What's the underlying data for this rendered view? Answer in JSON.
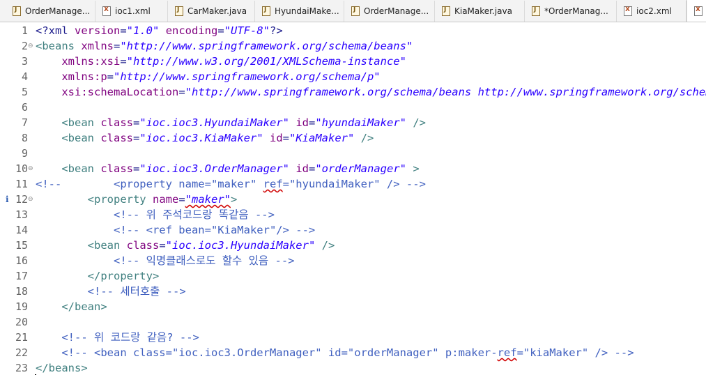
{
  "tabs": [
    {
      "label": "OrderManage...",
      "icon": "java-file-icon",
      "type": "java"
    },
    {
      "label": "ioc1.xml",
      "icon": "xml-file-icon",
      "type": "xml"
    },
    {
      "label": "CarMaker.java",
      "icon": "java-file-icon",
      "type": "java"
    },
    {
      "label": "HyundaiMake...",
      "icon": "java-file-icon",
      "type": "java"
    },
    {
      "label": "OrderManage...",
      "icon": "java-file-icon",
      "type": "java"
    },
    {
      "label": "KiaMaker.java",
      "icon": "java-file-icon",
      "type": "java"
    },
    {
      "label": "*OrderManag...",
      "icon": "java-file-icon",
      "type": "java"
    },
    {
      "label": "ioc2.xml",
      "icon": "xml-file-icon",
      "type": "xml"
    },
    {
      "label": "i",
      "icon": "xml-file-icon",
      "type": "xml",
      "active": true
    }
  ],
  "editor": {
    "lines": [
      {
        "n": "1",
        "t": [
          [
            "tg",
            "<?xml "
          ],
          [
            "an",
            "version"
          ],
          [
            "tg",
            "="
          ],
          [
            "av",
            "\"1.0\""
          ],
          [
            "tg",
            " "
          ],
          [
            "an",
            "encoding"
          ],
          [
            "tg",
            "="
          ],
          [
            "av",
            "\"UTF-8\""
          ],
          [
            "tg",
            "?>"
          ]
        ]
      },
      {
        "n": "2",
        "fold": true,
        "t": [
          [
            "tag",
            "<beans "
          ],
          [
            "an",
            "xmlns"
          ],
          [
            "tg",
            "="
          ],
          [
            "av",
            "\"http://www.springframework.org/schema/beans\""
          ]
        ]
      },
      {
        "n": "3",
        "t": [
          [
            "tg",
            "    "
          ],
          [
            "an",
            "xmlns:xsi"
          ],
          [
            "tg",
            "="
          ],
          [
            "av",
            "\"http://www.w3.org/2001/XMLSchema-instance\""
          ]
        ]
      },
      {
        "n": "4",
        "t": [
          [
            "tg",
            "    "
          ],
          [
            "an",
            "xmlns:p"
          ],
          [
            "tg",
            "="
          ],
          [
            "av",
            "\"http://www.springframework.org/schema/p\""
          ]
        ]
      },
      {
        "n": "5",
        "t": [
          [
            "tg",
            "    "
          ],
          [
            "an",
            "xsi:schemaLocation"
          ],
          [
            "tg",
            "="
          ],
          [
            "av",
            "\"http://www.springframework.org/schema/beans http://www.springframework.org/schema/beans/spring-beans.xsd\""
          ]
        ]
      },
      {
        "n": "6",
        "t": []
      },
      {
        "n": "7",
        "t": [
          [
            "tg",
            "    "
          ],
          [
            "tag",
            "<bean "
          ],
          [
            "an",
            "class"
          ],
          [
            "tg",
            "="
          ],
          [
            "av",
            "\"ioc.ioc3.HyundaiMaker\""
          ],
          [
            "tg",
            " "
          ],
          [
            "an",
            "id"
          ],
          [
            "tg",
            "="
          ],
          [
            "av",
            "\"hyundaiMaker\""
          ],
          [
            "tg",
            " "
          ],
          [
            "tag",
            "/>"
          ]
        ]
      },
      {
        "n": "8",
        "t": [
          [
            "tg",
            "    "
          ],
          [
            "tag",
            "<bean "
          ],
          [
            "an",
            "class"
          ],
          [
            "tg",
            "="
          ],
          [
            "av",
            "\"ioc.ioc3.KiaMaker\""
          ],
          [
            "tg",
            " "
          ],
          [
            "an",
            "id"
          ],
          [
            "tg",
            "="
          ],
          [
            "av",
            "\"KiaMaker\""
          ],
          [
            "tg",
            " "
          ],
          [
            "tag",
            "/>"
          ]
        ]
      },
      {
        "n": "9",
        "t": []
      },
      {
        "n": "10",
        "fold": true,
        "t": [
          [
            "tg",
            "    "
          ],
          [
            "tag",
            "<bean "
          ],
          [
            "an",
            "class"
          ],
          [
            "tg",
            "="
          ],
          [
            "av",
            "\"ioc.ioc3.OrderManager\""
          ],
          [
            "tg",
            " "
          ],
          [
            "an",
            "id"
          ],
          [
            "tg",
            "="
          ],
          [
            "av",
            "\"orderManager\""
          ],
          [
            "tg",
            " "
          ],
          [
            "tag",
            ">"
          ]
        ]
      },
      {
        "n": "11",
        "t": [
          [
            "cm",
            "<!--        <property name=\"maker\" "
          ],
          [
            "sqc",
            "ref"
          ],
          [
            "cm",
            "=\"hyundaiMaker\" /> -->"
          ]
        ]
      },
      {
        "n": "12",
        "fold": true,
        "marker": "i",
        "t": [
          [
            "tg",
            "        "
          ],
          [
            "tag",
            "<property "
          ],
          [
            "an",
            "name"
          ],
          [
            "tg",
            "="
          ],
          [
            "avs",
            "\"maker\""
          ],
          [
            "tag",
            ">"
          ]
        ]
      },
      {
        "n": "13",
        "t": [
          [
            "cm",
            "            <!-- 위 주석코드랑 똑같음 -->"
          ]
        ]
      },
      {
        "n": "14",
        "t": [
          [
            "cm",
            "            <!-- <ref bean=\"KiaMaker\"/> -->"
          ]
        ]
      },
      {
        "n": "15",
        "t": [
          [
            "tg",
            "        "
          ],
          [
            "tag",
            "<bean "
          ],
          [
            "an",
            "class"
          ],
          [
            "tg",
            "="
          ],
          [
            "av",
            "\"ioc.ioc3.HyundaiMaker\""
          ],
          [
            "tg",
            " "
          ],
          [
            "tag",
            "/>"
          ]
        ]
      },
      {
        "n": "16",
        "t": [
          [
            "cm",
            "            <!-- 익명클래스로도 할수 있음 -->"
          ]
        ]
      },
      {
        "n": "17",
        "t": [
          [
            "tg",
            "        "
          ],
          [
            "tag",
            "</property>"
          ]
        ]
      },
      {
        "n": "18",
        "t": [
          [
            "tg",
            "        "
          ],
          [
            "cm",
            "<!-- 세터호출 -->"
          ]
        ]
      },
      {
        "n": "19",
        "t": [
          [
            "tg",
            "    "
          ],
          [
            "tag",
            "</bean>"
          ]
        ]
      },
      {
        "n": "20",
        "t": []
      },
      {
        "n": "21",
        "t": [
          [
            "tg",
            "    "
          ],
          [
            "cm",
            "<!-- 위 코드랑 같음? -->"
          ]
        ]
      },
      {
        "n": "22",
        "t": [
          [
            "tg",
            "    "
          ],
          [
            "cm",
            "<!-- <bean class=\"ioc.ioc3.OrderManager\" id=\"orderManager\" p:maker-"
          ],
          [
            "sqc",
            "ref"
          ],
          [
            "cm",
            "=\"kiaMaker\" /> -->"
          ]
        ]
      },
      {
        "n": "23",
        "t": [
          [
            "tag",
            "</beans>"
          ]
        ]
      }
    ]
  }
}
